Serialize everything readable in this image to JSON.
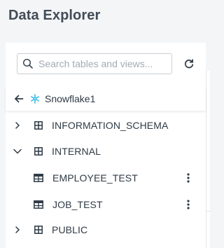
{
  "header": {
    "title": "Data Explorer"
  },
  "search": {
    "placeholder": "Search tables and views..."
  },
  "connection": {
    "name": "Snowflake1"
  },
  "tree": {
    "schemas": [
      {
        "label": "INFORMATION_SCHEMA",
        "expanded": false
      },
      {
        "label": "INTERNAL",
        "expanded": true,
        "tables": [
          {
            "label": "EMPLOYEE_TEST"
          },
          {
            "label": "JOB_TEST"
          }
        ]
      },
      {
        "label": "PUBLIC",
        "expanded": false
      }
    ]
  },
  "colors": {
    "snowflake": "#29b5e8",
    "text": "#2f3a45",
    "title": "#414c57",
    "placeholder": "#a3abb4"
  }
}
